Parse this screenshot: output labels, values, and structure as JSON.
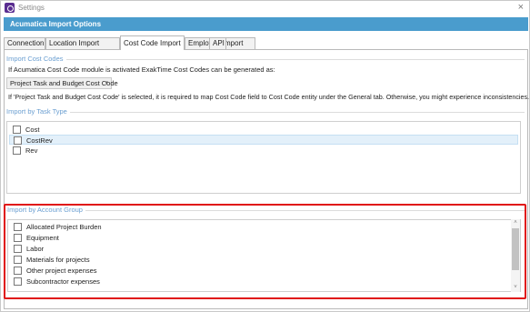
{
  "window": {
    "title": "Settings",
    "app_icon": "app-logo-icon",
    "close_glyph": "×"
  },
  "header": {
    "title": "Acumatica Import Options"
  },
  "tabs": [
    {
      "label": "Connection",
      "active": false
    },
    {
      "label": "Location Import",
      "active": false
    },
    {
      "label": "Cost Code Import",
      "active": true
    },
    {
      "label": "Employee Import",
      "active": false
    },
    {
      "label": "API",
      "active": false
    }
  ],
  "import_cost_codes": {
    "group_label": "Import Cost Codes",
    "description": "If Acumatica Cost Code module is activated ExakTime Cost Codes can be generated as:",
    "dropdown_value": "Project Task and Budget Cost Code",
    "dropdown_arrow": "▾",
    "warning": "If 'Project Task and Budget Cost Code' is selected, it is required to map Cost Code field to Cost Code entity under the General tab. Otherwise, you might experience inconsistencies."
  },
  "import_by_task_type": {
    "group_label": "Import by Task Type",
    "items": [
      {
        "label": "Cost",
        "checked": false,
        "selected": false
      },
      {
        "label": "CostRev",
        "checked": false,
        "selected": true
      },
      {
        "label": "Rev",
        "checked": false,
        "selected": false
      }
    ]
  },
  "import_by_account_group": {
    "group_label": "Import by Account Group",
    "items": [
      {
        "label": "Allocated Project Burden",
        "checked": false
      },
      {
        "label": "Equipment",
        "checked": false
      },
      {
        "label": "Labor",
        "checked": false
      },
      {
        "label": "Materials for projects",
        "checked": false
      },
      {
        "label": "Other project expenses",
        "checked": false
      },
      {
        "label": "Subcontractor expenses",
        "checked": false
      }
    ],
    "scroll_up_glyph": "˄",
    "scroll_down_glyph": "˅"
  },
  "colors": {
    "header_bg": "#4a9ccd",
    "group_label": "#6b9fd1",
    "highlight_border": "#e01414",
    "selected_row": "#e3f0fa"
  }
}
